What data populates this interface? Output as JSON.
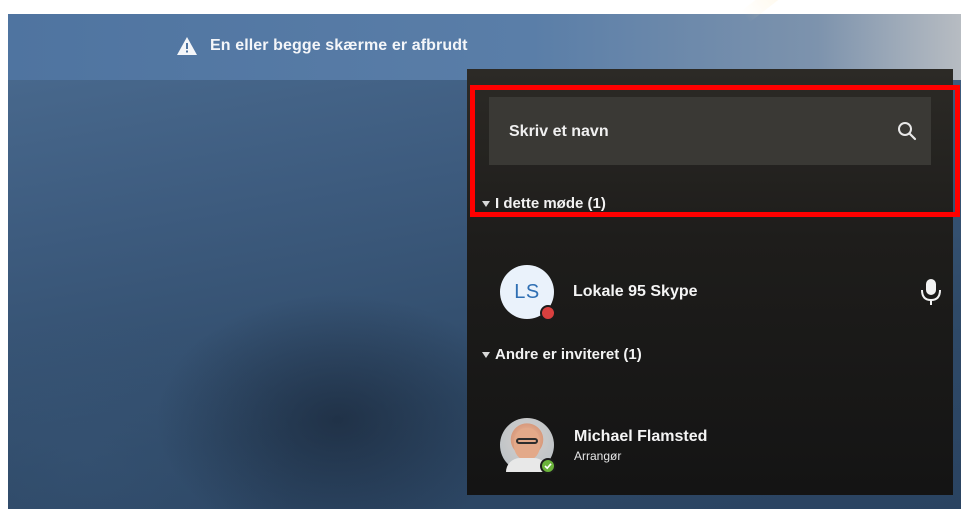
{
  "banner": {
    "warning_icon": "warning-triangle-icon",
    "text": "En eller begge skærme er afbrudt"
  },
  "search": {
    "placeholder": "Skriv et navn",
    "icon": "search-icon"
  },
  "sections": [
    {
      "label": "I dette møde (1)",
      "participants": [
        {
          "initials": "LS",
          "name": "Lokale 95 Skype",
          "status": "busy",
          "status_color": "#d9403f",
          "action_icon": "microphone-icon"
        }
      ]
    },
    {
      "label": "Andre er inviteret (1)",
      "participants": [
        {
          "name": "Michael Flamsted",
          "role": "Arrangør",
          "status": "available",
          "status_color": "#6bb33b"
        }
      ]
    }
  ],
  "colors": {
    "highlight": "#ff0000",
    "avatar_initials": "#2f6fb3",
    "panel_background": "#1e1d1b"
  }
}
